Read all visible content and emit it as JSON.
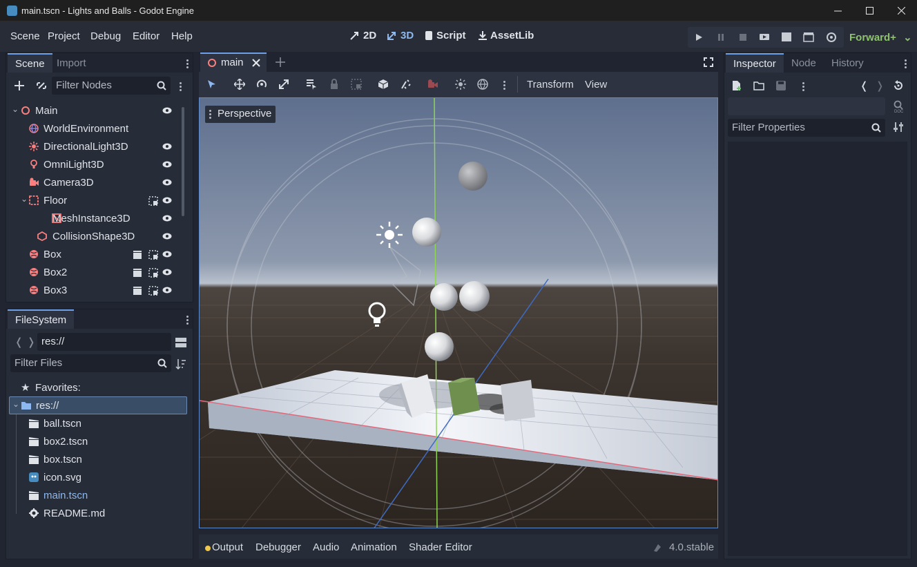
{
  "window": {
    "title": "main.tscn - Lights and Balls - Godot Engine",
    "controls": [
      "minimize",
      "maximize",
      "close"
    ]
  },
  "menu": {
    "items": [
      "Scene",
      "Project",
      "Debug",
      "Editor",
      "Help"
    ]
  },
  "main_screens": [
    {
      "label": "2D",
      "icon": "2d-icon"
    },
    {
      "label": "3D",
      "icon": "3d-icon",
      "active": true
    },
    {
      "label": "Script",
      "icon": "script-icon"
    },
    {
      "label": "AssetLib",
      "icon": "assetlib-icon"
    }
  ],
  "renderer": "Forward+",
  "scene_dock": {
    "tabs": [
      "Scene",
      "Import"
    ],
    "filter_placeholder": "Filter Nodes",
    "nodes": [
      {
        "label": "Main",
        "icon": "node3d-icon",
        "depth": 0,
        "collapsible": true,
        "visible_toggle": true
      },
      {
        "label": "WorldEnvironment",
        "icon": "world-environment-icon",
        "depth": 1
      },
      {
        "label": "DirectionalLight3D",
        "icon": "directional-light-icon",
        "depth": 1,
        "visible_toggle": true
      },
      {
        "label": "OmniLight3D",
        "icon": "omni-light-icon",
        "depth": 1,
        "visible_toggle": true
      },
      {
        "label": "Camera3D",
        "icon": "camera-icon",
        "depth": 1,
        "visible_toggle": true
      },
      {
        "label": "Floor",
        "icon": "static-body-icon",
        "depth": 1,
        "collapsible": true,
        "group_icon": true,
        "visible_toggle": true
      },
      {
        "label": "MeshInstance3D",
        "icon": "mesh-instance-icon",
        "depth": 2,
        "visible_toggle": true
      },
      {
        "label": "CollisionShape3D",
        "icon": "collision-shape-icon",
        "depth": 2,
        "visible_toggle": true
      },
      {
        "label": "Box",
        "icon": "rigid-body-icon",
        "depth": 1,
        "scene_icon": true,
        "group_icon": true,
        "visible_toggle": true
      },
      {
        "label": "Box2",
        "icon": "rigid-body-icon",
        "depth": 1,
        "scene_icon": true,
        "group_icon": true,
        "visible_toggle": true
      },
      {
        "label": "Box3",
        "icon": "rigid-body-icon",
        "depth": 1,
        "scene_icon": true,
        "group_icon": true,
        "visible_toggle": true
      }
    ]
  },
  "filesystem": {
    "tab": "FileSystem",
    "path": "res://",
    "filter_placeholder": "Filter Files",
    "favorites_label": "Favorites:",
    "root": "res://",
    "files": [
      {
        "label": "ball.tscn",
        "icon": "scene-file-icon"
      },
      {
        "label": "box2.tscn",
        "icon": "scene-file-icon"
      },
      {
        "label": "box.tscn",
        "icon": "scene-file-icon"
      },
      {
        "label": "icon.svg",
        "icon": "image-file-icon"
      },
      {
        "label": "main.tscn",
        "icon": "scene-file-icon",
        "highlight": true
      },
      {
        "label": "README.md",
        "icon": "text-file-icon"
      }
    ]
  },
  "editor_tabs": {
    "open": [
      {
        "label": "main",
        "icon": "node3d-icon"
      }
    ]
  },
  "viewport_toolbar": {
    "transform_menu": "Transform",
    "view_menu": "View"
  },
  "viewport": {
    "label": "Perspective"
  },
  "bottom_panel": {
    "items": [
      "Output",
      "Debugger",
      "Audio",
      "Animation",
      "Shader Editor"
    ],
    "version": "4.0.stable"
  },
  "inspector": {
    "tabs": [
      "Inspector",
      "Node",
      "History"
    ],
    "filter_placeholder": "Filter Properties"
  },
  "colors": {
    "accent": "#6ea1e8",
    "renderer": "#8ec26e",
    "node_icon": "#fc7f7f",
    "file_highlight": "#8eb8f0"
  }
}
